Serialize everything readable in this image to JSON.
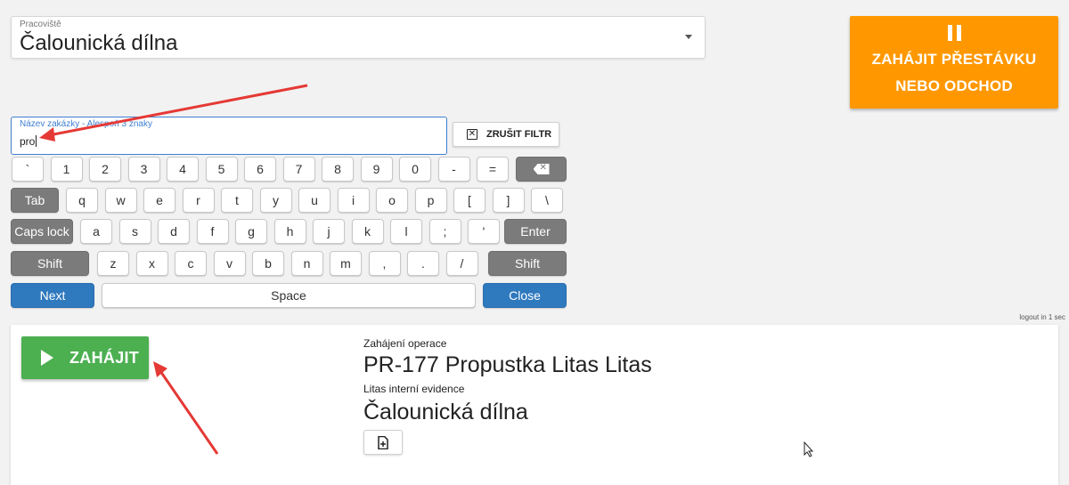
{
  "workplace": {
    "label": "Pracoviště",
    "value": "Čalounická dílna"
  },
  "pause_button": {
    "line1": "ZAHÁJIT PŘESTÁVKU",
    "line2": "NEBO ODCHOD",
    "color": "#ff9800"
  },
  "filter": {
    "label": "Název zakázky - Alespoň 3 znaky",
    "value": "pro"
  },
  "cancel_filter": {
    "label": "ZRUŠIT FILTR"
  },
  "keyboard": {
    "row1": [
      "`",
      "1",
      "2",
      "3",
      "4",
      "5",
      "6",
      "7",
      "8",
      "9",
      "0",
      "-",
      "="
    ],
    "row2_tab": "Tab",
    "row2": [
      "q",
      "w",
      "e",
      "r",
      "t",
      "y",
      "u",
      "i",
      "o",
      "p",
      "[",
      "]",
      "\\"
    ],
    "row3_caps": "Caps lock",
    "row3": [
      "a",
      "s",
      "d",
      "f",
      "g",
      "h",
      "j",
      "k",
      "l",
      ";",
      "'"
    ],
    "row3_enter": "Enter",
    "row4_shift": "Shift",
    "row4": [
      "z",
      "x",
      "c",
      "v",
      "b",
      "n",
      "m",
      ",",
      ".",
      "/"
    ],
    "row5_next": "Next",
    "row5_space": "Space",
    "row5_close": "Close"
  },
  "logout_text": "logout in 1 sec",
  "start_button": {
    "label": "ZAHÁJIT",
    "color": "#4caf50"
  },
  "operation": {
    "start_label": "Zahájení operace",
    "title": "PR-177 Propustka Litas Litas",
    "subtitle": "Litas interní evidence",
    "workplace": "Čalounická dílna"
  },
  "icons": {
    "doc_add": "file-plus-icon",
    "pause": "pause-icon",
    "play": "play-icon",
    "backspace": "backspace-icon"
  }
}
